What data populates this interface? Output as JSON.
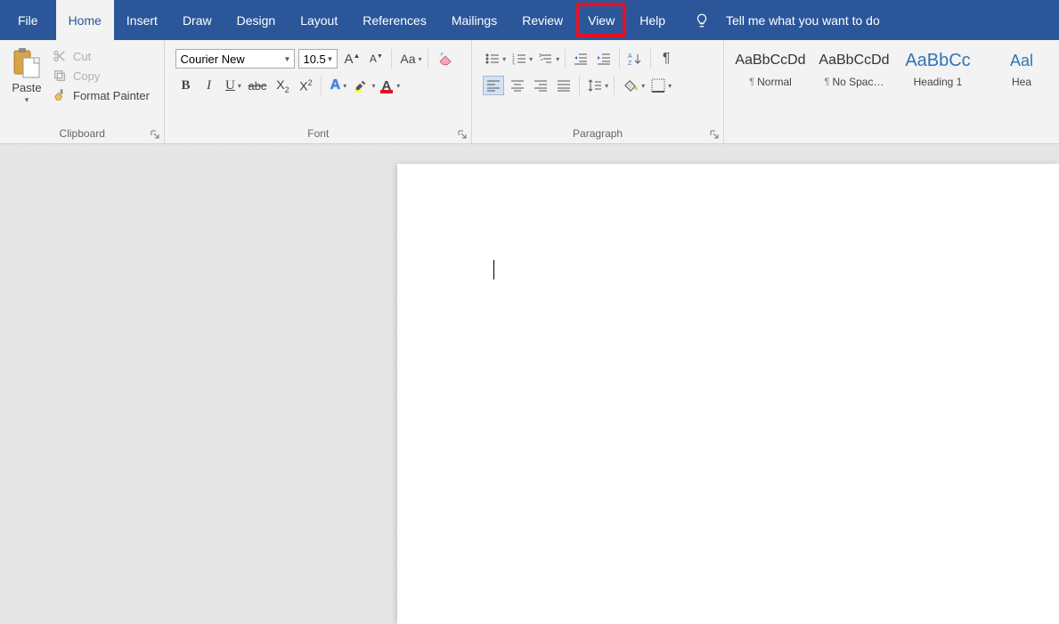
{
  "tabs": {
    "file": "File",
    "home": "Home",
    "insert": "Insert",
    "draw": "Draw",
    "design": "Design",
    "layout": "Layout",
    "references": "References",
    "mailings": "Mailings",
    "review": "Review",
    "view": "View",
    "help": "Help"
  },
  "tellme": "Tell me what you want to do",
  "clipboard": {
    "paste": "Paste",
    "cut": "Cut",
    "copy": "Copy",
    "format_painter": "Format Painter",
    "group_label": "Clipboard"
  },
  "font": {
    "name": "Courier New",
    "size": "10.5",
    "group_label": "Font"
  },
  "paragraph": {
    "group_label": "Paragraph"
  },
  "styles": {
    "items": [
      {
        "sample": "AaBbCcDd",
        "name": "Normal",
        "pilcrow": true,
        "class": ""
      },
      {
        "sample": "AaBbCcDd",
        "name": "No Spac…",
        "pilcrow": true,
        "class": ""
      },
      {
        "sample": "AaBbCc",
        "name": "Heading 1",
        "pilcrow": false,
        "class": "heading"
      },
      {
        "sample": "Aal",
        "name": "Hea",
        "pilcrow": false,
        "class": "heading2"
      }
    ]
  }
}
